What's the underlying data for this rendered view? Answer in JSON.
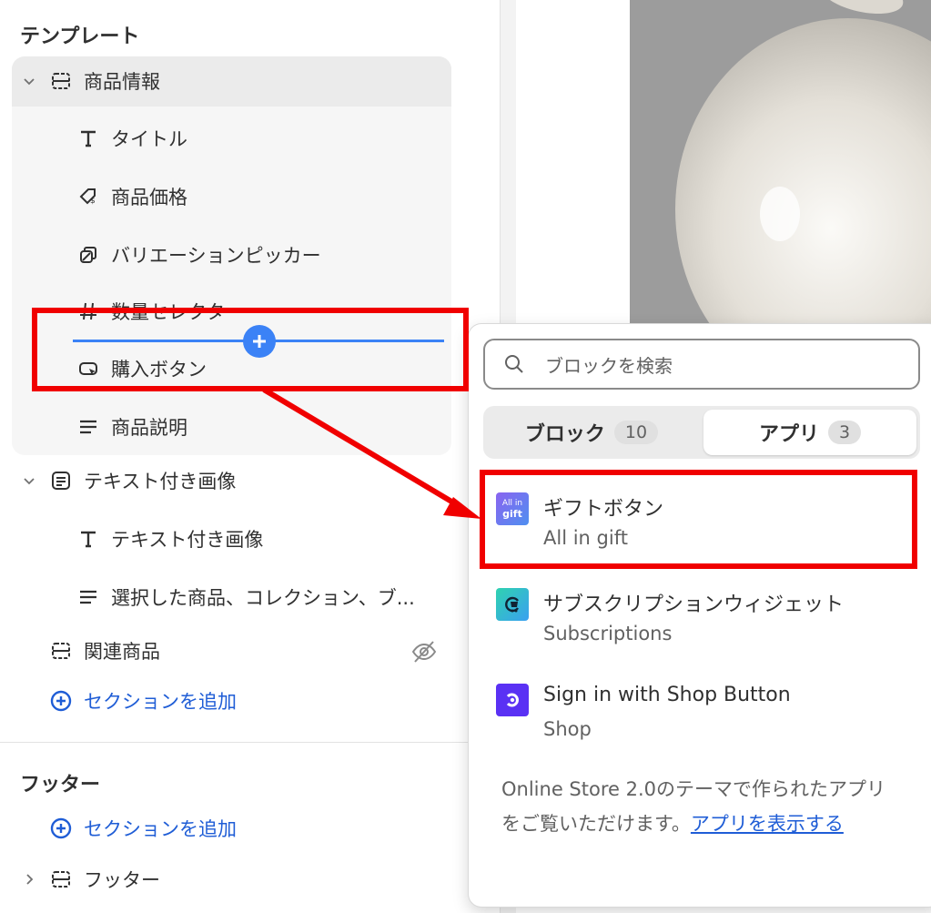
{
  "sidebar": {
    "template_heading": "テンプレート",
    "product_info": {
      "label": "商品情報",
      "blocks": [
        {
          "icon": "text-icon",
          "label": "タイトル"
        },
        {
          "icon": "price-tag-icon",
          "label": "商品価格"
        },
        {
          "icon": "variant-picker-icon",
          "label": "バリエーションピッカー"
        },
        {
          "icon": "hash-icon",
          "label": "数量セレクタ"
        },
        {
          "icon": "buy-button-icon",
          "label": "購入ボタン"
        },
        {
          "icon": "paragraph-icon",
          "label": "商品説明"
        }
      ]
    },
    "image_with_text": {
      "label": "テキスト付き画像",
      "blocks": [
        {
          "icon": "text-icon",
          "label": "テキスト付き画像"
        },
        {
          "icon": "paragraph-icon",
          "label": "選択した商品、コレクション、ブ..."
        }
      ]
    },
    "related_products": {
      "label": "関連商品",
      "hidden": true
    },
    "add_section_label": "セクションを追加",
    "footer_heading": "フッター",
    "footer_add_section_label": "セクションを追加",
    "footer_item_label": "フッター"
  },
  "popover": {
    "search_placeholder": "ブロックを検索",
    "tabs": [
      {
        "label": "ブロック",
        "count": "10",
        "selected": false
      },
      {
        "label": "アプリ",
        "count": "3",
        "selected": true
      }
    ],
    "apps": [
      {
        "name": "ギフトボタン",
        "provider": "All in gift",
        "icon_text_1": "All in",
        "icon_text_2": "gift",
        "icon_color": "#7a5ce6"
      },
      {
        "name": "サブスクリプションウィジェット",
        "provider": "Subscriptions",
        "icon_color": "#1fbf9b"
      },
      {
        "name": "Sign in with Shop Button",
        "provider": "Shop",
        "icon_color": "#5a31f4"
      }
    ],
    "footer_text": "Online Store 2.0のテーマで作られたアプリをご覧いただけます。",
    "footer_link": "アプリを表示する"
  },
  "colors": {
    "annotation_red": "#f00000",
    "accent_blue": "#1f5dd6",
    "insert_line_blue": "#3b82f6"
  }
}
